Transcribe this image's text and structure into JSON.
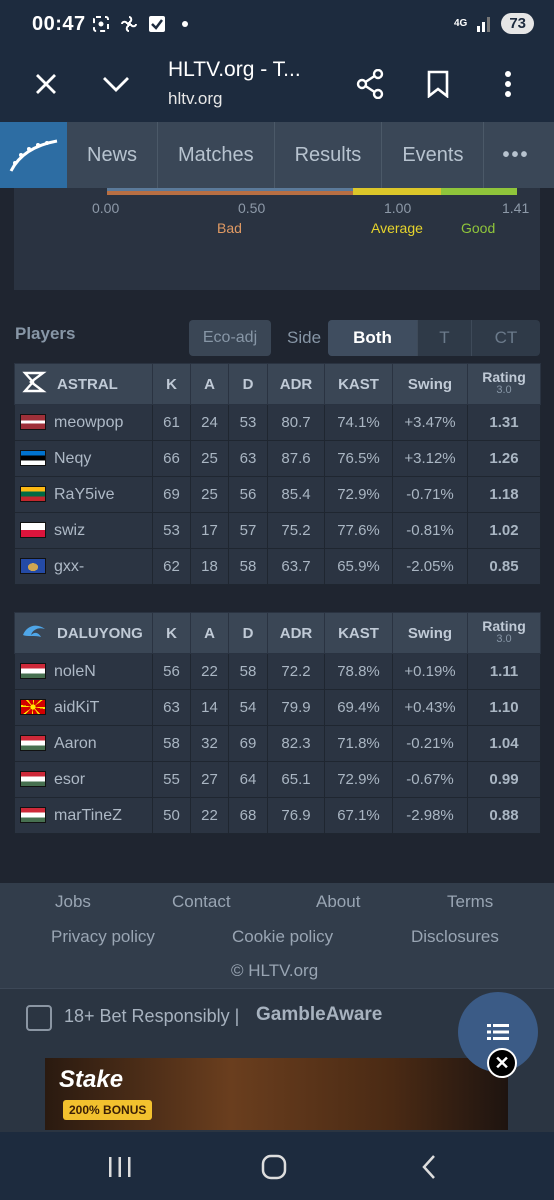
{
  "status_bar": {
    "time": "00:47",
    "network": "4G",
    "battery": "73"
  },
  "browser": {
    "title": "HLTV.org - T...",
    "url": "hltv.org"
  },
  "nav": {
    "items": [
      "News",
      "Matches",
      "Results",
      "Events"
    ],
    "more": "•••"
  },
  "rating_scale": {
    "ticks": [
      "0.00",
      "0.50",
      "1.00",
      "1.41"
    ],
    "labels": [
      "Bad",
      "Average",
      "Good"
    ],
    "colors": {
      "bad": "#e09a63",
      "average": "#e6d42c",
      "good": "#8fc53b"
    }
  },
  "players_section": {
    "title": "Players",
    "eco_adj": "Eco-adj",
    "side_label": "Side",
    "side_options": [
      "Both",
      "T",
      "CT"
    ],
    "selected_side": "Both"
  },
  "columns": {
    "k": "K",
    "a": "A",
    "d": "D",
    "adr": "ADR",
    "kast": "KAST",
    "swing": "Swing",
    "rating": "Rating",
    "rating_version": "3.0"
  },
  "teams": [
    {
      "name": "ASTRAL",
      "players": [
        {
          "name": "meowpop",
          "flag": "latvia",
          "k": "61",
          "a": "24",
          "d": "53",
          "adr": "80.7",
          "kast": "74.1%",
          "swing": "+3.47%",
          "swing_type": "pos",
          "rating": "1.31",
          "rating_type": "good"
        },
        {
          "name": "Neqy",
          "flag": "estonia",
          "k": "66",
          "a": "25",
          "d": "63",
          "adr": "87.6",
          "kast": "76.5%",
          "swing": "+3.12%",
          "swing_type": "pos",
          "rating": "1.26",
          "rating_type": "good"
        },
        {
          "name": "RaY5ive",
          "flag": "lithuania",
          "k": "69",
          "a": "25",
          "d": "56",
          "adr": "85.4",
          "kast": "72.9%",
          "swing": "-0.71%",
          "swing_type": "neu",
          "rating": "1.18",
          "rating_type": "good"
        },
        {
          "name": "swiz",
          "flag": "poland",
          "k": "53",
          "a": "17",
          "d": "57",
          "adr": "75.2",
          "kast": "77.6%",
          "swing": "-0.81%",
          "swing_type": "neu",
          "rating": "1.02",
          "rating_type": "avg"
        },
        {
          "name": "gxx-",
          "flag": "kosovo",
          "k": "62",
          "a": "18",
          "d": "58",
          "adr": "63.7",
          "kast": "65.9%",
          "swing": "-2.05%",
          "swing_type": "neg",
          "rating": "0.85",
          "rating_type": "bad"
        }
      ]
    },
    {
      "name": "DALUYONG",
      "players": [
        {
          "name": "noleN",
          "flag": "hungary",
          "k": "56",
          "a": "22",
          "d": "58",
          "adr": "72.2",
          "kast": "78.8%",
          "swing": "+0.19%",
          "swing_type": "neu",
          "rating": "1.11",
          "rating_type": "good"
        },
        {
          "name": "aidKiT",
          "flag": "north-macedonia",
          "k": "63",
          "a": "14",
          "d": "54",
          "adr": "79.9",
          "kast": "69.4%",
          "swing": "+0.43%",
          "swing_type": "neu",
          "rating": "1.10",
          "rating_type": "good"
        },
        {
          "name": "Aaron",
          "flag": "hungary",
          "k": "58",
          "a": "32",
          "d": "69",
          "adr": "82.3",
          "kast": "71.8%",
          "swing": "-0.21%",
          "swing_type": "neu",
          "rating": "1.04",
          "rating_type": "avg"
        },
        {
          "name": "esor",
          "flag": "hungary",
          "k": "55",
          "a": "27",
          "d": "64",
          "adr": "65.1",
          "kast": "72.9%",
          "swing": "-0.67%",
          "swing_type": "neu",
          "rating": "0.99",
          "rating_type": "avg"
        },
        {
          "name": "marTineZ",
          "flag": "hungary",
          "k": "50",
          "a": "22",
          "d": "68",
          "adr": "76.9",
          "kast": "67.1%",
          "swing": "-2.98%",
          "swing_type": "neg",
          "rating": "0.88",
          "rating_type": "bad"
        }
      ]
    }
  ],
  "footer": {
    "links": [
      "Jobs",
      "Contact",
      "About",
      "Terms",
      "Privacy policy",
      "Cookie policy",
      "Disclosures"
    ],
    "copyright": "© HLTV.org"
  },
  "gambling": {
    "text": "18+ Bet Responsibly  |",
    "brand": "GambleAware"
  },
  "ad": {
    "brand": "Stake",
    "bonus": "200% BONUS"
  },
  "icons": {
    "close": "close-icon",
    "chevron": "chevron-down-icon",
    "share": "share-icon",
    "bookmark": "bookmark-icon",
    "menu": "kebab-menu-icon",
    "hltv_logo": "hltv-logo-icon"
  }
}
